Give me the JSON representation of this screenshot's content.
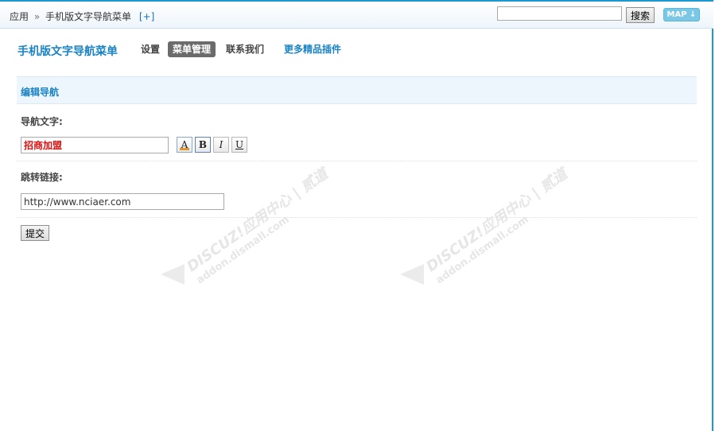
{
  "breadcrumb": {
    "root": "应用",
    "separator": "»",
    "current": "手机版文字导航菜单",
    "add_label": "[+]"
  },
  "search": {
    "value": "",
    "button_label": "搜索"
  },
  "map_button": {
    "label": "MAP ↓"
  },
  "header": {
    "plugin_title": "手机版文字导航菜单",
    "menu": {
      "settings": "设置",
      "manage": "菜单管理",
      "contact": "联系我们",
      "more": "更多精品插件"
    }
  },
  "section": {
    "title": "编辑导航"
  },
  "form": {
    "nav_text_label": "导航文字:",
    "nav_text_value": "招商加盟",
    "format_buttons": {
      "color": "A",
      "bold": "B",
      "italic": "I",
      "underline": "U"
    },
    "link_label": "跳转链接:",
    "link_value": "http://www.nciaer.com",
    "submit_label": "提交"
  },
  "watermark": {
    "brand": "DISCUZ!应用中心 | 贰道",
    "site": "addon.dismall.com"
  },
  "colors": {
    "accent": "#1a83c5",
    "active_tab": "#6b6b6b",
    "nav_text": "#e01010",
    "section_bg": "#eef6fd"
  }
}
